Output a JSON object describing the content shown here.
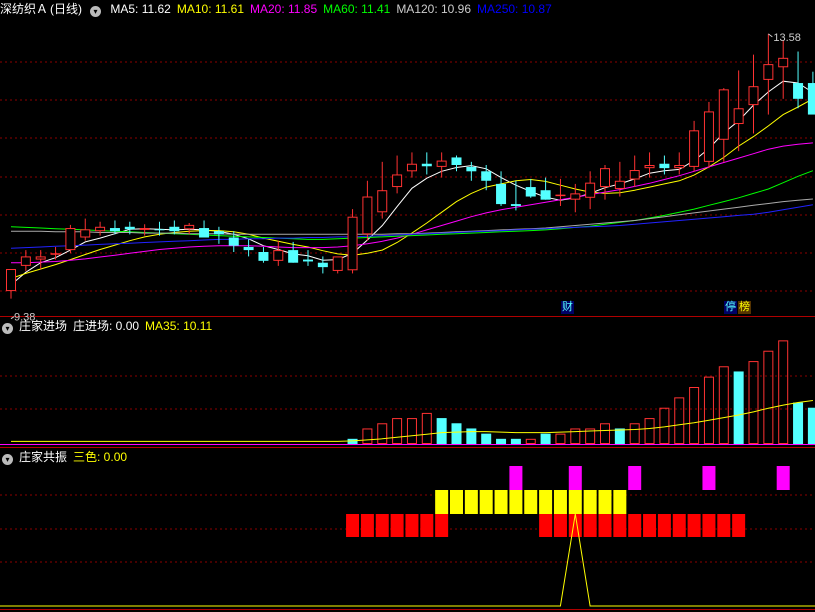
{
  "header_main": {
    "stock": "深纺织Ａ",
    "period": "(日线)",
    "ma": [
      {
        "label": "MA5: 11.62",
        "color": "#ffffff"
      },
      {
        "label": "MA10: 11.61",
        "color": "#ffff00"
      },
      {
        "label": "MA20: 11.85",
        "color": "#ff00ff"
      },
      {
        "label": "MA60: 11.41",
        "color": "#00ff00"
      },
      {
        "label": "MA120: 10.96",
        "color": "#cccccc"
      },
      {
        "label": "MA250: 10.87",
        "color": "#0000ff"
      }
    ]
  },
  "header_p2": {
    "name": "庄家进场",
    "label": "庄进场: 0.00",
    "ma_label": "MA35: 10.11"
  },
  "header_p3": {
    "name": "庄家共振",
    "label": "三色: 0.00"
  },
  "markers": {
    "high": "13.58",
    "low": "9.38",
    "badge_cai": "财",
    "badge_ting": "停",
    "badge_bang": "榜"
  },
  "colors": {
    "up": "#ff3232",
    "down": "#54ffff",
    "grid": "#8b0000",
    "ma5": "#ffffff",
    "ma10": "#ffff00",
    "ma20": "#ff00ff",
    "ma60": "#00ff00",
    "ma120": "#aaaaaa",
    "ma250": "#2222ff",
    "red_block": "#ff0000",
    "yellow_block": "#ffff00",
    "magenta_block": "#ff00ff"
  },
  "chart_data": [
    {
      "type": "candlestick",
      "name": "price",
      "ylim": [
        9.2,
        13.8
      ],
      "x": [
        0,
        1,
        2,
        3,
        4,
        5,
        6,
        7,
        8,
        9,
        10,
        11,
        12,
        13,
        14,
        15,
        16,
        17,
        18,
        19,
        20,
        21,
        22,
        23,
        24,
        25,
        26,
        27,
        28,
        29,
        30,
        31,
        32,
        33,
        34,
        35,
        36,
        37,
        38,
        39,
        40,
        41,
        42,
        43,
        44,
        45,
        46,
        47,
        48,
        49,
        50,
        51,
        52,
        53,
        54
      ],
      "open": [
        9.5,
        9.9,
        10.0,
        10.08,
        10.15,
        10.35,
        10.45,
        10.5,
        10.52,
        10.47,
        10.48,
        10.52,
        10.48,
        10.5,
        10.45,
        10.35,
        10.2,
        10.12,
        9.98,
        10.15,
        10.0,
        9.95,
        9.82,
        9.83,
        10.4,
        10.75,
        11.15,
        11.4,
        11.52,
        11.47,
        11.62,
        11.47,
        11.4,
        11.2,
        10.88,
        11.15,
        11.1,
        11.03,
        10.95,
        10.98,
        11.15,
        11.12,
        11.27,
        11.45,
        11.52,
        11.45,
        11.47,
        11.55,
        11.9,
        12.15,
        12.45,
        12.85,
        13.05,
        12.8,
        12.8
      ],
      "high": [
        9.72,
        10.15,
        10.15,
        10.2,
        10.55,
        10.65,
        10.6,
        10.62,
        10.6,
        10.56,
        10.6,
        10.62,
        10.58,
        10.62,
        10.52,
        10.45,
        10.32,
        10.2,
        10.3,
        10.28,
        10.15,
        10.05,
        10.0,
        10.8,
        11.25,
        11.55,
        11.65,
        11.7,
        11.7,
        11.7,
        11.65,
        11.55,
        11.5,
        11.4,
        11.25,
        11.28,
        11.3,
        11.28,
        11.2,
        11.4,
        11.5,
        11.55,
        11.65,
        11.7,
        11.65,
        11.7,
        12.2,
        12.5,
        12.72,
        13.0,
        13.25,
        13.58,
        13.48,
        13.3,
        12.98
      ],
      "low": [
        9.38,
        9.82,
        9.85,
        10.0,
        10.1,
        10.3,
        10.38,
        10.4,
        10.4,
        10.38,
        10.38,
        10.4,
        10.4,
        10.35,
        10.25,
        10.12,
        10.05,
        9.95,
        9.9,
        9.95,
        9.9,
        9.78,
        9.78,
        9.78,
        10.3,
        10.65,
        11.05,
        11.3,
        11.35,
        11.3,
        11.4,
        11.25,
        11.1,
        10.85,
        10.78,
        10.98,
        10.95,
        10.85,
        10.75,
        10.8,
        10.95,
        11.0,
        11.15,
        11.3,
        11.35,
        11.35,
        11.4,
        11.45,
        11.55,
        11.72,
        12.0,
        12.3,
        12.55,
        12.4,
        12.4
      ],
      "close": [
        9.85,
        10.05,
        10.05,
        10.1,
        10.5,
        10.48,
        10.52,
        10.45,
        10.48,
        10.5,
        10.47,
        10.45,
        10.55,
        10.35,
        10.4,
        10.22,
        10.15,
        9.98,
        10.15,
        9.95,
        9.97,
        9.88,
        10.05,
        10.68,
        11.0,
        11.1,
        11.35,
        11.52,
        11.48,
        11.57,
        11.5,
        11.4,
        11.25,
        10.88,
        10.85,
        11.0,
        10.95,
        11.03,
        11.05,
        11.22,
        11.45,
        11.25,
        11.42,
        11.5,
        11.45,
        11.5,
        12.05,
        12.35,
        12.7,
        12.4,
        12.75,
        13.1,
        13.2,
        12.55,
        12.3
      ]
    },
    {
      "type": "line",
      "name": "MA5",
      "color": "#ffffff",
      "values": [
        9.6,
        9.8,
        9.95,
        10.03,
        10.15,
        10.28,
        10.34,
        10.41,
        10.48,
        10.49,
        10.48,
        10.47,
        10.48,
        10.47,
        10.45,
        10.4,
        10.33,
        10.22,
        10.16,
        10.09,
        10.06,
        9.99,
        10.0,
        10.1,
        10.31,
        10.54,
        10.84,
        11.13,
        11.29,
        11.4,
        11.46,
        11.49,
        11.44,
        11.3,
        11.18,
        11.08,
        10.99,
        10.94,
        10.98,
        11.05,
        11.14,
        11.2,
        11.28,
        11.37,
        11.41,
        11.43,
        11.57,
        11.76,
        12.01,
        12.2,
        12.45,
        12.66,
        12.83,
        12.8,
        12.65
      ]
    },
    {
      "type": "line",
      "name": "MA10",
      "color": "#ffff00",
      "values": [
        9.7,
        9.78,
        9.85,
        9.92,
        10.0,
        10.08,
        10.16,
        10.23,
        10.3,
        10.36,
        10.4,
        10.43,
        10.45,
        10.46,
        10.46,
        10.44,
        10.4,
        10.34,
        10.29,
        10.24,
        10.2,
        10.14,
        10.09,
        10.07,
        10.1,
        10.15,
        10.27,
        10.42,
        10.58,
        10.75,
        10.92,
        11.05,
        11.15,
        11.2,
        11.25,
        11.27,
        11.24,
        11.18,
        11.12,
        11.07,
        11.05,
        11.06,
        11.1,
        11.15,
        11.2,
        11.25,
        11.34,
        11.47,
        11.62,
        11.8,
        11.95,
        12.12,
        12.3,
        12.42,
        12.55
      ]
    },
    {
      "type": "line",
      "name": "MA20",
      "color": "#ff00ff",
      "values": [
        9.95,
        9.95,
        9.96,
        9.97,
        9.99,
        10.01,
        10.04,
        10.07,
        10.1,
        10.13,
        10.16,
        10.18,
        10.2,
        10.21,
        10.22,
        10.22,
        10.22,
        10.21,
        10.2,
        10.19,
        10.19,
        10.19,
        10.2,
        10.22,
        10.25,
        10.29,
        10.34,
        10.4,
        10.47,
        10.54,
        10.61,
        10.68,
        10.74,
        10.79,
        10.83,
        10.87,
        10.91,
        10.95,
        10.99,
        11.03,
        11.07,
        11.11,
        11.16,
        11.21,
        11.27,
        11.33,
        11.4,
        11.47,
        11.54,
        11.61,
        11.68,
        11.75,
        11.8,
        11.83,
        11.85
      ]
    },
    {
      "type": "line",
      "name": "MA60",
      "color": "#00ff00",
      "values": [
        10.52,
        10.51,
        10.5,
        10.49,
        10.48,
        10.47,
        10.46,
        10.45,
        10.44,
        10.43,
        10.42,
        10.41,
        10.4,
        10.39,
        10.38,
        10.37,
        10.36,
        10.35,
        10.34,
        10.33,
        10.32,
        10.32,
        10.33,
        10.34,
        10.35,
        10.36,
        10.37,
        10.38,
        10.39,
        10.4,
        10.41,
        10.42,
        10.43,
        10.44,
        10.45,
        10.46,
        10.47,
        10.49,
        10.51,
        10.53,
        10.56,
        10.59,
        10.62,
        10.66,
        10.7,
        10.75,
        10.8,
        10.86,
        10.92,
        10.98,
        11.05,
        11.12,
        11.22,
        11.32,
        11.41
      ]
    },
    {
      "type": "line",
      "name": "MA120",
      "color": "#aaaaaa",
      "values": [
        10.45,
        10.45,
        10.45,
        10.44,
        10.44,
        10.44,
        10.43,
        10.43,
        10.43,
        10.42,
        10.42,
        10.42,
        10.41,
        10.41,
        10.41,
        10.4,
        10.4,
        10.4,
        10.4,
        10.4,
        10.4,
        10.4,
        10.4,
        10.4,
        10.4,
        10.4,
        10.41,
        10.41,
        10.42,
        10.43,
        10.44,
        10.45,
        10.46,
        10.47,
        10.48,
        10.49,
        10.5,
        10.52,
        10.54,
        10.56,
        10.58,
        10.6,
        10.62,
        10.65,
        10.68,
        10.71,
        10.74,
        10.77,
        10.8,
        10.83,
        10.86,
        10.89,
        10.92,
        10.94,
        10.96
      ]
    },
    {
      "type": "line",
      "name": "MA250",
      "color": "#2222ff",
      "values": [
        10.18,
        10.19,
        10.2,
        10.21,
        10.22,
        10.23,
        10.24,
        10.25,
        10.26,
        10.27,
        10.28,
        10.29,
        10.3,
        10.31,
        10.32,
        10.32,
        10.33,
        10.33,
        10.34,
        10.34,
        10.35,
        10.35,
        10.36,
        10.36,
        10.37,
        10.38,
        10.39,
        10.4,
        10.41,
        10.42,
        10.43,
        10.44,
        10.45,
        10.46,
        10.47,
        10.48,
        10.49,
        10.5,
        10.51,
        10.52,
        10.53,
        10.54,
        10.56,
        10.58,
        10.6,
        10.62,
        10.64,
        10.66,
        10.68,
        10.7,
        10.72,
        10.75,
        10.79,
        10.83,
        10.87
      ]
    },
    {
      "type": "bar",
      "name": "庄进场",
      "ylim": [
        0,
        22
      ],
      "values": [
        0,
        0,
        0,
        0,
        0,
        0,
        0,
        0,
        0,
        0,
        0,
        0,
        0,
        0,
        0,
        0,
        0,
        0,
        0,
        0,
        0,
        0,
        0,
        1,
        3,
        4,
        5,
        5,
        6,
        5,
        4,
        3,
        2,
        1,
        1,
        1,
        2,
        2,
        3,
        3,
        4,
        3,
        4,
        5,
        7,
        9,
        11,
        13,
        15,
        14,
        16,
        18,
        20,
        8,
        7
      ],
      "up": [
        0,
        0,
        0,
        0,
        0,
        0,
        0,
        0,
        0,
        0,
        0,
        0,
        0,
        0,
        0,
        0,
        0,
        0,
        0,
        0,
        0,
        0,
        0,
        0,
        1,
        1,
        1,
        1,
        1,
        0,
        0,
        0,
        0,
        0,
        0,
        1,
        0,
        1,
        1,
        1,
        1,
        0,
        1,
        1,
        1,
        1,
        1,
        1,
        1,
        0,
        1,
        1,
        1,
        0,
        0
      ],
      "ma": [
        0.5,
        0.5,
        0.5,
        0.5,
        0.5,
        0.5,
        0.5,
        0.5,
        0.5,
        0.5,
        0.5,
        0.5,
        0.5,
        0.5,
        0.5,
        0.5,
        0.5,
        0.5,
        0.5,
        0.5,
        0.5,
        0.5,
        0.5,
        0.6,
        0.8,
        1.0,
        1.3,
        1.6,
        1.9,
        2.2,
        2.3,
        2.4,
        2.4,
        2.3,
        2.2,
        2.2,
        2.2,
        2.3,
        2.4,
        2.5,
        2.6,
        2.7,
        2.8,
        3.0,
        3.3,
        3.7,
        4.1,
        4.6,
        5.1,
        5.6,
        6.2,
        6.9,
        7.5,
        8.0,
        8.4
      ]
    },
    {
      "type": "blocks",
      "name": "三色",
      "red": [
        0,
        0,
        0,
        0,
        0,
        0,
        0,
        0,
        0,
        0,
        0,
        0,
        0,
        0,
        0,
        0,
        0,
        0,
        0,
        0,
        0,
        0,
        0,
        1,
        1,
        1,
        1,
        1,
        1,
        1,
        0,
        0,
        0,
        0,
        0,
        0,
        1,
        1,
        1,
        1,
        1,
        1,
        1,
        1,
        1,
        1,
        1,
        1,
        1,
        1,
        0,
        0,
        0,
        0,
        0
      ],
      "yellow": [
        0,
        0,
        0,
        0,
        0,
        0,
        0,
        0,
        0,
        0,
        0,
        0,
        0,
        0,
        0,
        0,
        0,
        0,
        0,
        0,
        0,
        0,
        0,
        0,
        0,
        0,
        0,
        0,
        0,
        1,
        1,
        1,
        1,
        1,
        1,
        1,
        1,
        1,
        1,
        1,
        1,
        1,
        0,
        0,
        0,
        0,
        0,
        0,
        0,
        0,
        0,
        0,
        0,
        0,
        0
      ],
      "magenta": [
        0,
        0,
        0,
        0,
        0,
        0,
        0,
        0,
        0,
        0,
        0,
        0,
        0,
        0,
        0,
        0,
        0,
        0,
        0,
        0,
        0,
        0,
        0,
        0,
        0,
        0,
        0,
        0,
        0,
        0,
        0,
        0,
        0,
        0,
        1,
        0,
        0,
        0,
        1,
        0,
        0,
        0,
        1,
        0,
        0,
        0,
        0,
        1,
        0,
        0,
        0,
        0,
        1,
        0,
        0
      ],
      "line": [
        0,
        0,
        0,
        0,
        0,
        0,
        0,
        0,
        0,
        0,
        0,
        0,
        0,
        0,
        0,
        0,
        0,
        0,
        0,
        0,
        0,
        0,
        0,
        0,
        0,
        0,
        0,
        0,
        0,
        0,
        0,
        0,
        0,
        0,
        0,
        0,
        0,
        0,
        1,
        0,
        0,
        0,
        0,
        0,
        0,
        0,
        0,
        0,
        0,
        0,
        0,
        0,
        0,
        0,
        0
      ]
    }
  ]
}
